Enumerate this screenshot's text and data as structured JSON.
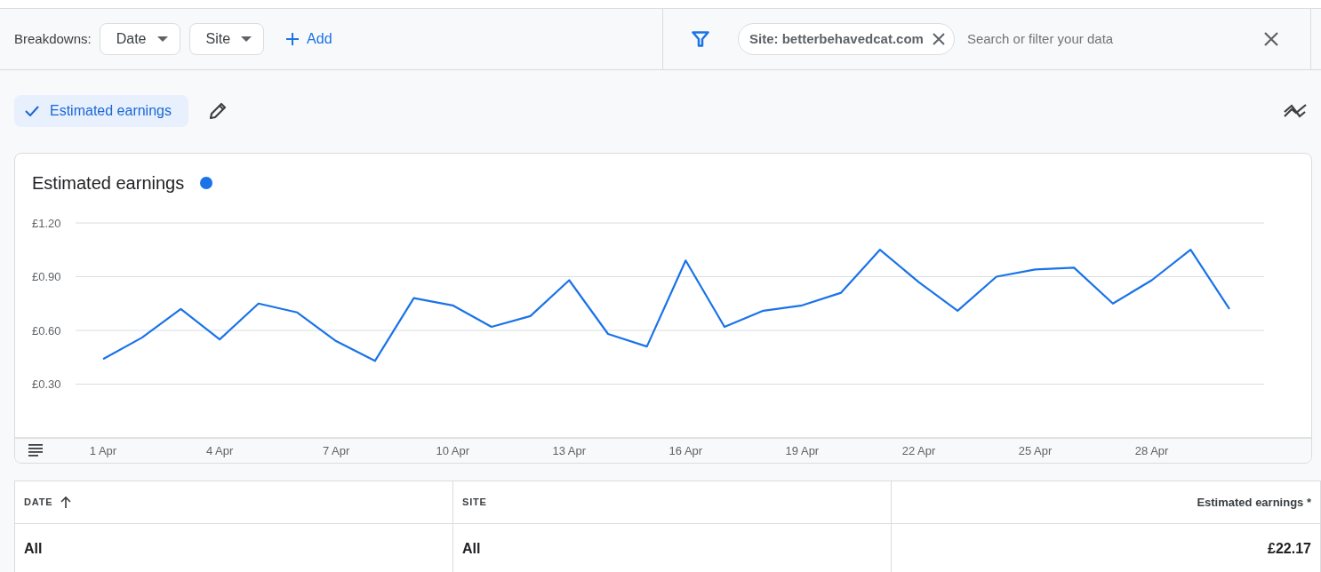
{
  "breakdowns": {
    "label": "Breakdowns:",
    "chips": [
      {
        "label": "Date"
      },
      {
        "label": "Site"
      }
    ],
    "add_label": "Add"
  },
  "filter": {
    "chip": "Site: betterbehavedcat.com",
    "search": {
      "placeholder": "Search or filter your data"
    }
  },
  "metrics": [
    {
      "label": "Estimated earnings",
      "selected": true
    }
  ],
  "chart": {
    "title": "Estimated earnings",
    "chart_data": {
      "type": "line",
      "categories": [
        "1 Apr",
        null,
        null,
        "4 Apr",
        null,
        null,
        "7 Apr",
        null,
        null,
        "10 Apr",
        null,
        null,
        "13 Apr",
        null,
        null,
        "16 Apr",
        null,
        null,
        "19 Apr",
        null,
        null,
        "22 Apr",
        null,
        null,
        "25 Apr",
        null,
        null,
        "28 Apr",
        null,
        null
      ],
      "ylim": [
        0,
        1.2
      ],
      "grid": true,
      "series": [
        {
          "color": "#1a73e8",
          "values": [
            0.44,
            0.56,
            0.72,
            0.55,
            0.75,
            0.7,
            0.54,
            0.43,
            0.78,
            0.74,
            0.62,
            0.68,
            0.88,
            0.58,
            0.51,
            0.99,
            0.62,
            0.71,
            0.74,
            0.81,
            1.05,
            0.87,
            0.71,
            0.9,
            0.94,
            0.95,
            0.75,
            0.88,
            1.05,
            0.72
          ]
        }
      ],
      "yticks": [
        {
          "value": 0.3,
          "label": "£0.30"
        },
        {
          "value": 0.6,
          "label": "£0.60"
        },
        {
          "value": 0.9,
          "label": "£0.90"
        },
        {
          "value": 1.2,
          "label": "£1.20"
        }
      ]
    }
  },
  "table": {
    "columns": [
      {
        "label": "DATE",
        "sorted": true
      },
      {
        "label": "SITE",
        "sorted": false
      },
      {
        "label": "Estimated earnings *",
        "sorted": false
      }
    ],
    "rows": [
      [
        "All",
        "All",
        "£22.17"
      ]
    ]
  }
}
